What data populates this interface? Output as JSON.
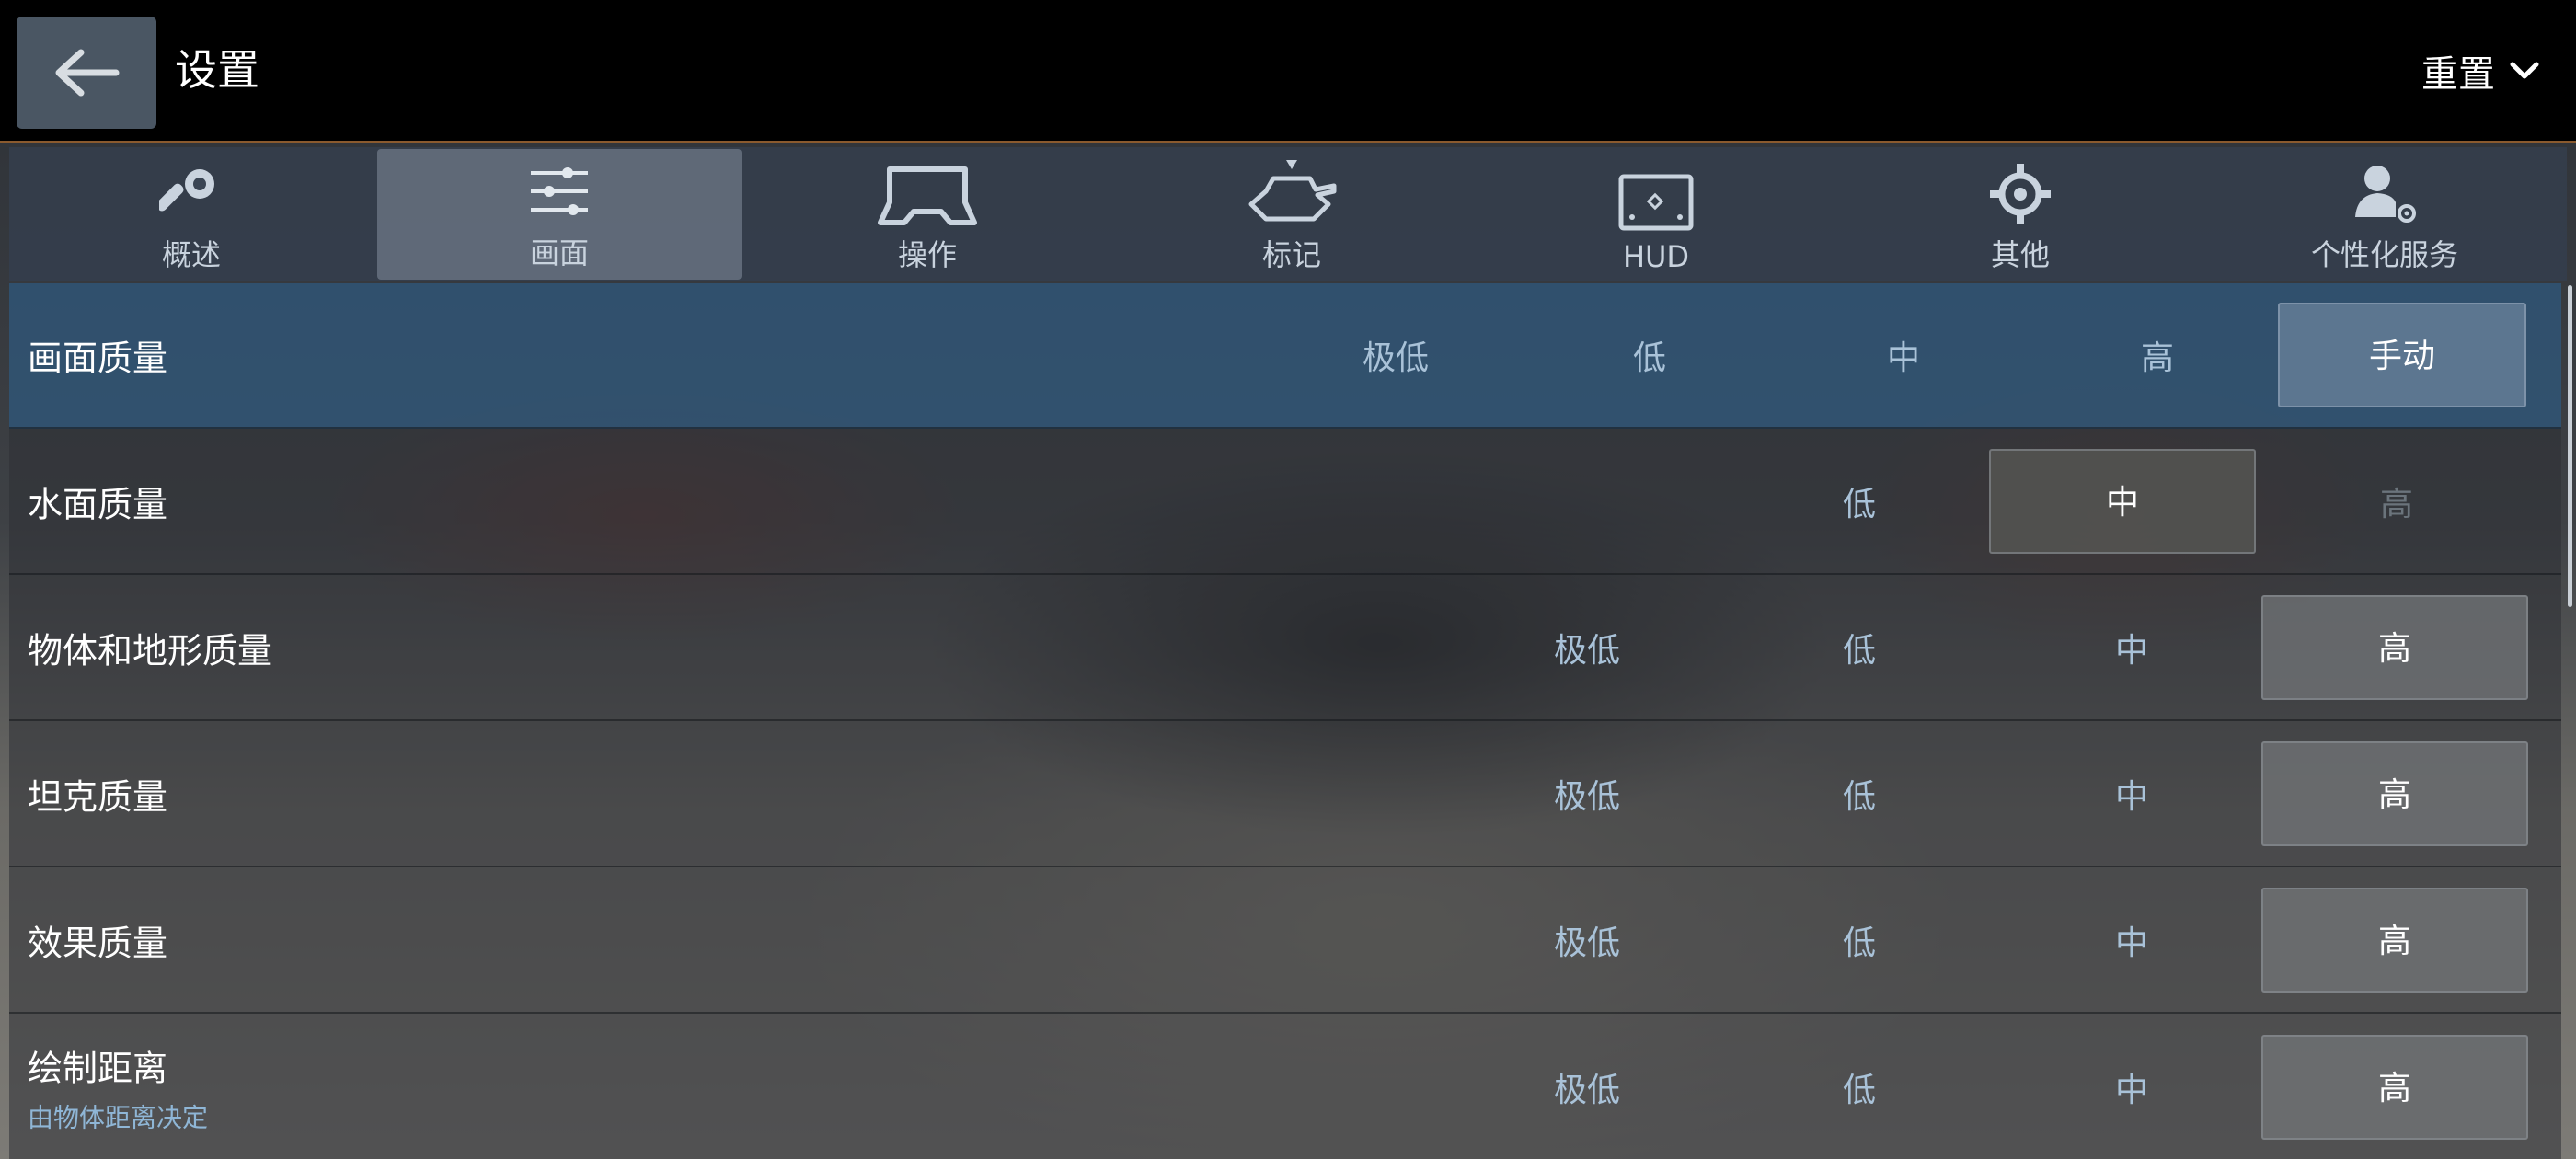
{
  "header": {
    "title": "设置",
    "reset_label": "重置"
  },
  "tabs": [
    {
      "label": "概述",
      "icon": "wrench-icon"
    },
    {
      "label": "画面",
      "icon": "sliders-icon",
      "active": true
    },
    {
      "label": "操作",
      "icon": "controller-icon"
    },
    {
      "label": "标记",
      "icon": "tank-marker-icon"
    },
    {
      "label": "HUD",
      "icon": "hud-icon"
    },
    {
      "label": "其他",
      "icon": "gear-icon"
    },
    {
      "label": "个性化服务",
      "icon": "user-gear-icon"
    }
  ],
  "settings": [
    {
      "label": "画面质量",
      "options": [
        "极低",
        "低",
        "中",
        "高",
        "手动"
      ],
      "selected": "手动"
    },
    {
      "label": "水面质量",
      "options": [
        "低",
        "中",
        "高"
      ],
      "selected": "中",
      "disabled": [
        "高"
      ]
    },
    {
      "label": "物体和地形质量",
      "options": [
        "极低",
        "低",
        "中",
        "高"
      ],
      "selected": "高"
    },
    {
      "label": "坦克质量",
      "options": [
        "极低",
        "低",
        "中",
        "高"
      ],
      "selected": "高"
    },
    {
      "label": "效果质量",
      "options": [
        "极低",
        "低",
        "中",
        "高"
      ],
      "selected": "高"
    },
    {
      "label": "绘制距离",
      "sublabel": "由物体距离决定",
      "options": [
        "极低",
        "低",
        "中",
        "高"
      ],
      "selected": "高"
    }
  ],
  "colors": {
    "accent_line": "#8a5a2e",
    "header_row": "#305678",
    "option_text": "#a9c2d8"
  }
}
